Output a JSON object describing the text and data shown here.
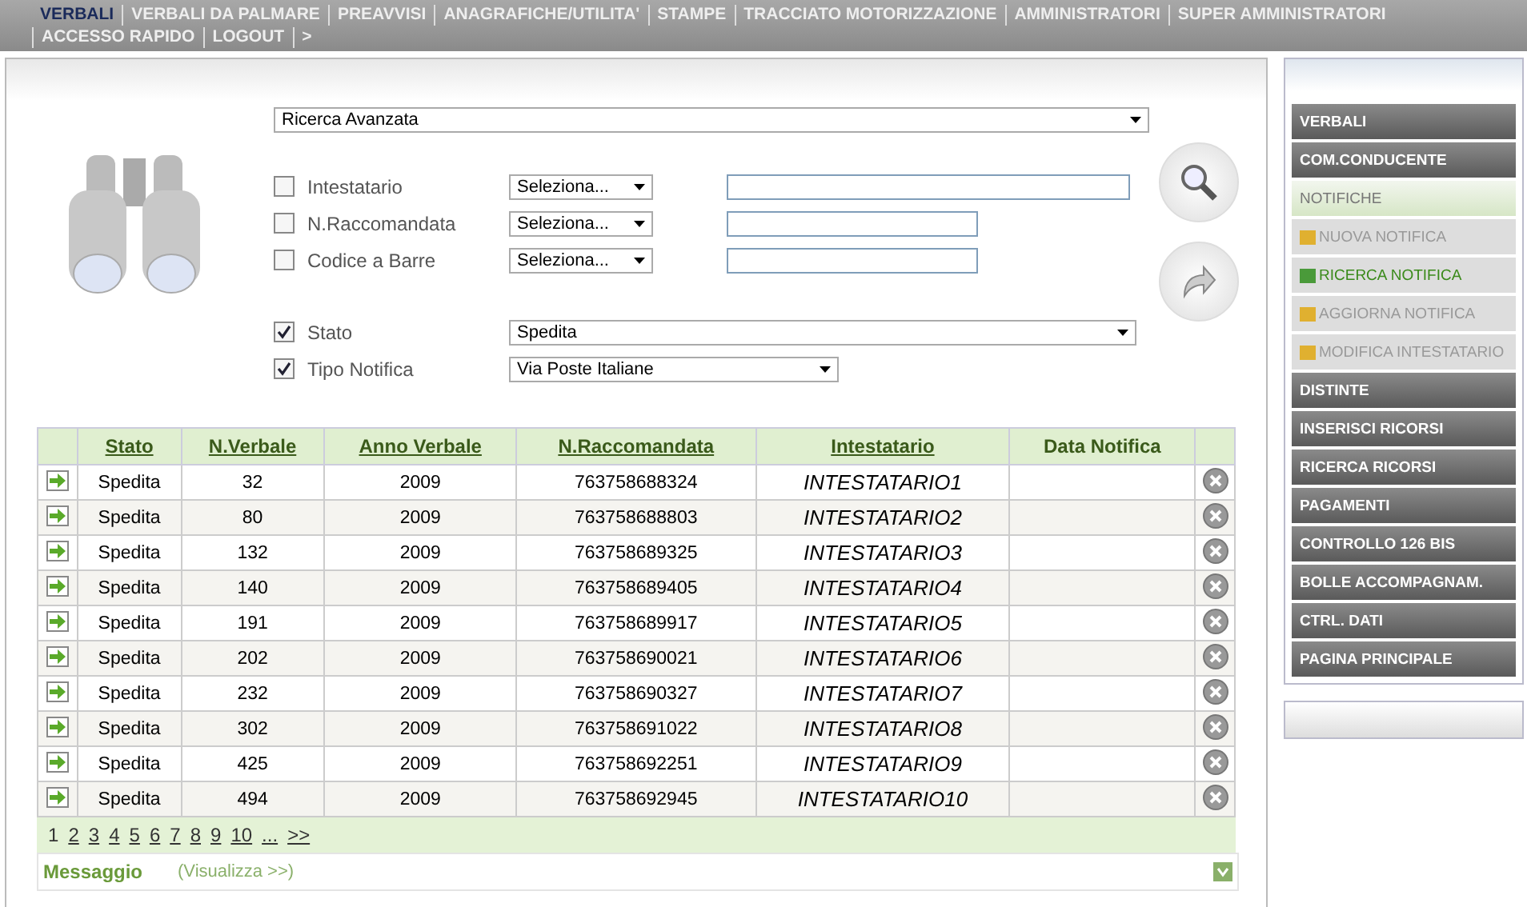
{
  "nav": [
    {
      "label": "VERBALI",
      "selected": true
    },
    {
      "label": "VERBALI DA PALMARE",
      "selected": false
    },
    {
      "label": "PREAVVISI",
      "selected": false
    },
    {
      "label": "ANAGRAFICHE/UTILITA'",
      "selected": false
    },
    {
      "label": "STAMPE",
      "selected": false
    },
    {
      "label": "TRACCIATO MOTORIZZAZIONE",
      "selected": false
    },
    {
      "label": "AMMINISTRATORI",
      "selected": false
    },
    {
      "label": "SUPER AMMINISTRATORI",
      "selected": false
    },
    {
      "label": "ACCESSO RAPIDO",
      "selected": false
    },
    {
      "label": "LOGOUT",
      "selected": false
    },
    {
      "label": ">",
      "selected": false
    }
  ],
  "search": {
    "mode": "Ricerca Avanzata",
    "filters": [
      {
        "kind": "text",
        "label": "Intestatario",
        "checked": false,
        "operator": "Seleziona..."
      },
      {
        "kind": "text",
        "label": "N.Raccomandata",
        "checked": false,
        "operator": "Seleziona..."
      },
      {
        "kind": "text",
        "label": "Codice a Barre",
        "checked": false,
        "operator": "Seleziona..."
      },
      {
        "kind": "choice",
        "label": "Stato",
        "checked": true,
        "value": "Spedita"
      },
      {
        "kind": "choice",
        "label": "Tipo Notifica",
        "checked": true,
        "value": "Via Poste Italiane"
      }
    ]
  },
  "table": {
    "columns": [
      "Stato",
      "N.Verbale",
      "Anno Verbale",
      "N.Raccomandata",
      "Intestatario",
      "Data Notifica"
    ],
    "rows": [
      [
        "Spedita",
        "32",
        "2009",
        "763758688324",
        "INTESTATARIO1"
      ],
      [
        "Spedita",
        "80",
        "2009",
        "763758688803",
        "INTESTATARIO2"
      ],
      [
        "Spedita",
        "132",
        "2009",
        "763758689325",
        "INTESTATARIO3"
      ],
      [
        "Spedita",
        "140",
        "2009",
        "763758689405",
        "INTESTATARIO4"
      ],
      [
        "Spedita",
        "191",
        "2009",
        "763758689917",
        "INTESTATARIO5"
      ],
      [
        "Spedita",
        "202",
        "2009",
        "763758690021",
        "INTESTATARIO6"
      ],
      [
        "Spedita",
        "232",
        "2009",
        "763758690327",
        "INTESTATARIO7"
      ],
      [
        "Spedita",
        "302",
        "2009",
        "763758691022",
        "INTESTATARIO8"
      ],
      [
        "Spedita",
        "425",
        "2009",
        "763758692251",
        "INTESTATARIO9"
      ],
      [
        "Spedita",
        "494",
        "2009",
        "763758692945",
        "INTESTATARIO10"
      ]
    ]
  },
  "pagination": [
    {
      "label": "1",
      "selected": true
    },
    {
      "label": "2",
      "selected": false
    },
    {
      "label": "3",
      "selected": false
    },
    {
      "label": "4",
      "selected": false
    },
    {
      "label": "5",
      "selected": false
    },
    {
      "label": "6",
      "selected": false
    },
    {
      "label": "7",
      "selected": false
    },
    {
      "label": "8",
      "selected": false
    },
    {
      "label": "9",
      "selected": false
    },
    {
      "label": "10",
      "selected": false
    },
    {
      "label": "...",
      "selected": false
    },
    {
      "label": ">>",
      "selected": false
    }
  ],
  "message": {
    "title": "Messaggio",
    "link": "(Visualizza >>)"
  },
  "sidebar": [
    {
      "kind": "section",
      "label": "VERBALI"
    },
    {
      "kind": "section",
      "label": "COM.CONDUCENTE"
    },
    {
      "kind": "header",
      "label": "NOTIFICHE"
    },
    {
      "kind": "sub",
      "label": "NUOVA NOTIFICA",
      "selected": false
    },
    {
      "kind": "sub",
      "label": "RICERCA NOTIFICA",
      "selected": true
    },
    {
      "kind": "sub",
      "label": "AGGIORNA NOTIFICA",
      "selected": false
    },
    {
      "kind": "sub",
      "label": "MODIFICA INTESTATARIO",
      "selected": false
    },
    {
      "kind": "section",
      "label": "DISTINTE"
    },
    {
      "kind": "section",
      "label": "INSERISCI RICORSI"
    },
    {
      "kind": "section",
      "label": "RICERCA RICORSI"
    },
    {
      "kind": "section",
      "label": "PAGAMENTI"
    },
    {
      "kind": "section",
      "label": "CONTROLLO 126 BIS"
    },
    {
      "kind": "section",
      "label": "BOLLE ACCOMPAGNAM."
    },
    {
      "kind": "section",
      "label": "CTRL. DATI"
    },
    {
      "kind": "section",
      "label": "PAGINA PRINCIPALE"
    }
  ]
}
